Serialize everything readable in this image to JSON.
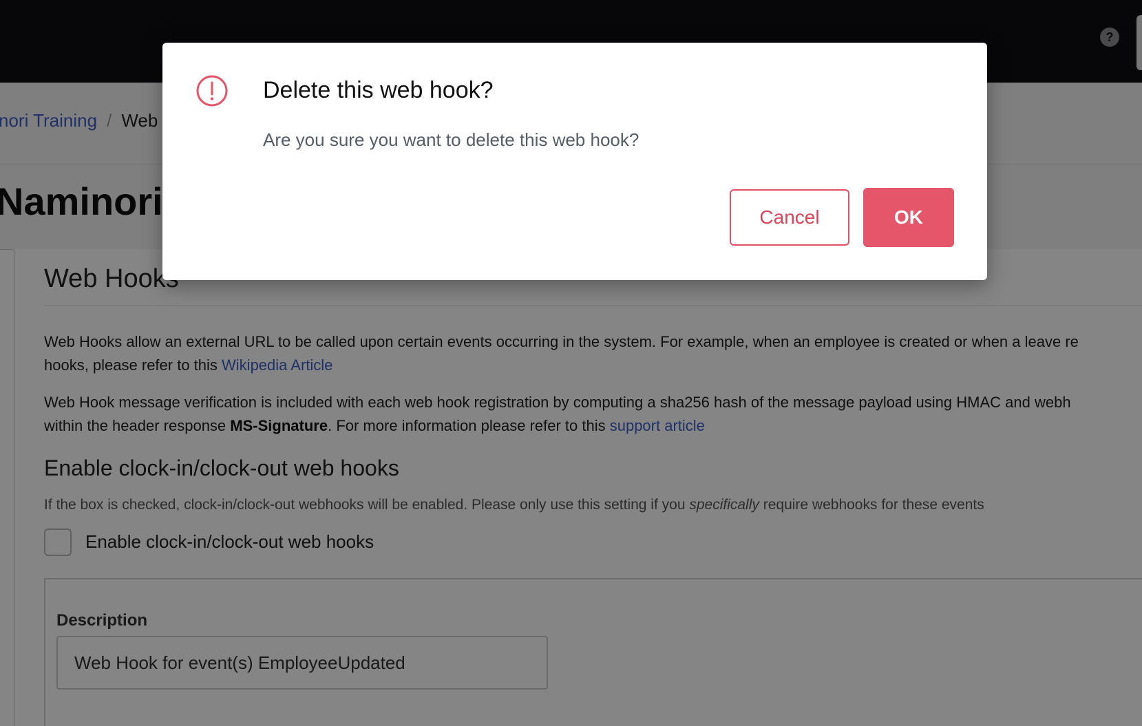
{
  "topbar": {
    "help_icon_glyph": "?",
    "help_icon": "question-circle-icon"
  },
  "breadcrumb": {
    "items": [
      "nori Training",
      "Web"
    ],
    "separator": "/"
  },
  "page": {
    "heading": "Naminori T"
  },
  "webhooks": {
    "title": "Web Hooks",
    "para1_line1": "Web Hooks allow an external URL to be called upon certain events occurring in the system. For example, when an employee is created or when a leave re",
    "para1_line2_prefix": "hooks, please refer to this ",
    "para1_link": "Wikipedia Article",
    "para2_line1": "Web Hook message verification is included with each web hook registration by computing a sha256 hash of the message payload using HMAC and webh",
    "para2_line2_prefix": "within the header response ",
    "para2_bold": "MS-Signature",
    "para2_line2_mid": ". For more information please refer to this ",
    "para2_link": "support article",
    "clock_heading": "Enable clock-in/clock-out web hooks",
    "clock_help_prefix": "If the box is checked, clock-in/clock-out webhooks will be enabled. Please only use this setting if you ",
    "clock_help_emphasis": "specifically",
    "clock_help_suffix": " require webhooks for these events",
    "checkbox_label": "Enable clock-in/clock-out web hooks",
    "checkbox_checked": false,
    "description_label": "Description",
    "description_value": "Web Hook for event(s) EmployeeUpdated"
  },
  "modal": {
    "title": "Delete this web hook?",
    "message": "Are you sure you want to delete this web hook?",
    "cancel_label": "Cancel",
    "ok_label": "OK",
    "icon": "exclamation-circle-icon",
    "accent_color": "#e5566a"
  }
}
